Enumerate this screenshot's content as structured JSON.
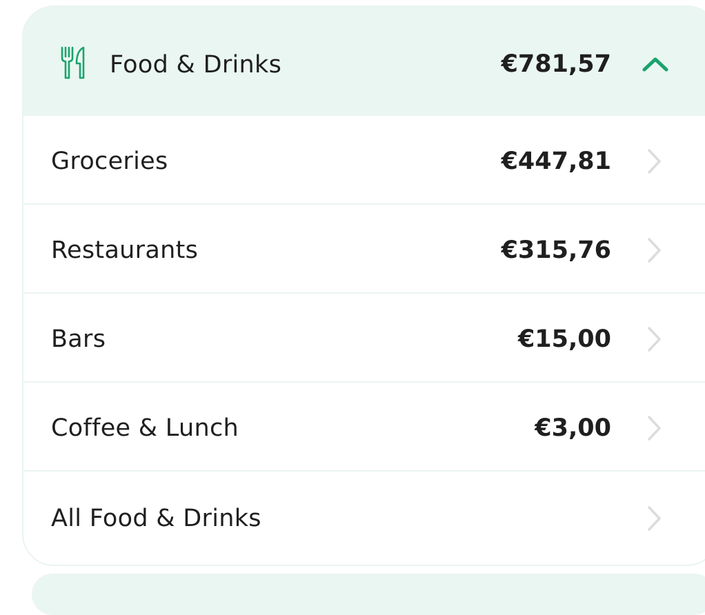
{
  "category": {
    "title": "Food & Drinks",
    "total": "€781,57",
    "icon": "fork-knife-icon",
    "expanded": true
  },
  "subcategories": [
    {
      "label": "Groceries",
      "amount": "€447,81"
    },
    {
      "label": "Restaurants",
      "amount": "€315,76"
    },
    {
      "label": "Bars",
      "amount": "€15,00"
    },
    {
      "label": "Coffee & Lunch",
      "amount": "€3,00"
    },
    {
      "label": "All Food & Drinks",
      "amount": ""
    }
  ],
  "colors": {
    "accent": "#1aa36f",
    "header_bg": "#eaf6f1",
    "text": "#1f1f1f",
    "chevron": "#dcdcdc",
    "divider": "#e9f4f0"
  }
}
